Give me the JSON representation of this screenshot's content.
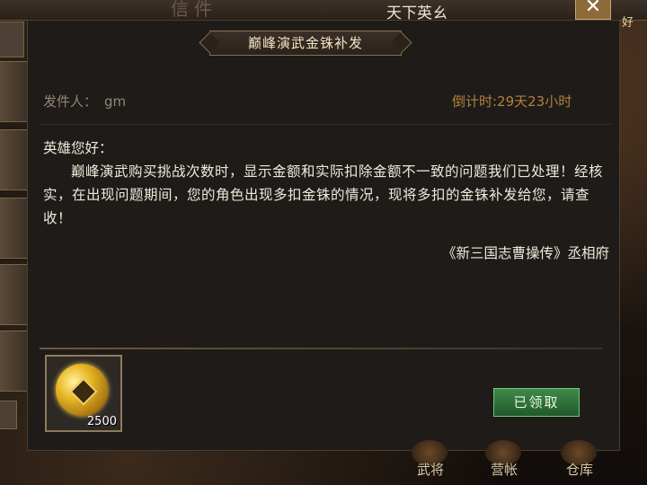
{
  "header": {
    "faded_title": "信件",
    "title": "天下英ㄠ",
    "close_label": "✕",
    "right_hint": "好"
  },
  "mail": {
    "subject": "巅峰演武金铢补发",
    "sender_label": "发件人：",
    "sender_name": "gm",
    "countdown": "倒计时:29天23小时",
    "greeting": "英雄您好：",
    "message": "巅峰演武购买挑战次数时，显示金额和实际扣除金额不一致的问题我们已处理！经核实，在出现问题期间，您的角色出现多扣金铢的情况，现将多扣的金铢补发给您，请查收！",
    "signature": "《新三国志曹操传》丞相府"
  },
  "attachment": {
    "icon": "gold-coin-icon",
    "quantity": "2500"
  },
  "claim_button": {
    "label": "已领取"
  },
  "bottom_nav": {
    "items": [
      "武将",
      "营帐",
      "仓库"
    ]
  },
  "colors": {
    "panel_bg": "#1f1b18",
    "countdown": "#b0823e",
    "claimed_button": "#2f7a3c",
    "gold": "#e8b826"
  }
}
